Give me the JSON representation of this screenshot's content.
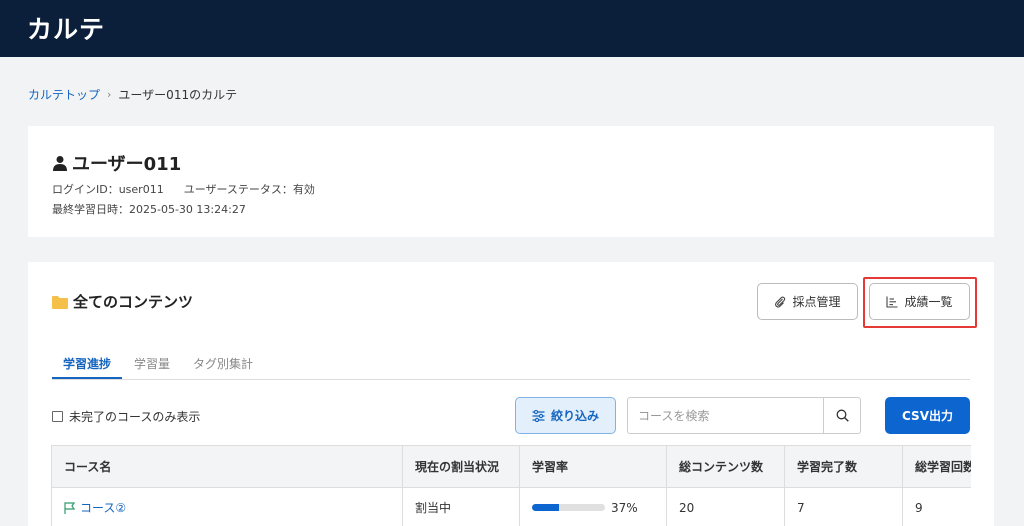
{
  "header": {
    "title": "カルテ"
  },
  "breadcrumb": {
    "top_link": "カルテトップ",
    "current": "ユーザー011のカルテ"
  },
  "user": {
    "name": "ユーザー011",
    "login_id": "ログインID：user011",
    "status": "ユーザーステータス：有効",
    "last_study": "最終学習日時：2025-05-30 13:24:27"
  },
  "content": {
    "title": "全てのコンテンツ",
    "grade_button": "採点管理",
    "results_button": "成績一覧",
    "tabs": [
      {
        "label": "学習進捗",
        "active": true
      },
      {
        "label": "学習量",
        "active": false
      },
      {
        "label": "タグ別集計",
        "active": false
      }
    ],
    "filter_checkbox_label": "未完了のコースのみ表示",
    "filter_checkbox_checked": false,
    "filter_button": "絞り込み",
    "search_placeholder": "コースを検索",
    "search_value": "",
    "csv_button": "CSV出力"
  },
  "table": {
    "headers": [
      "コース名",
      "現在の割当状況",
      "学習率",
      "総コンテンツ数",
      "学習完了数",
      "総学習回数"
    ],
    "rows": [
      {
        "course": "コース②",
        "assignment": "割当中",
        "progress": 0.37,
        "progress_label": "37%",
        "total": "20",
        "completed": "7",
        "count": "9"
      }
    ]
  },
  "colors": {
    "header_bg": "#0b1f3a",
    "accent": "#0d66d0",
    "highlight": "#e53935",
    "folder": "#f5c04a"
  }
}
